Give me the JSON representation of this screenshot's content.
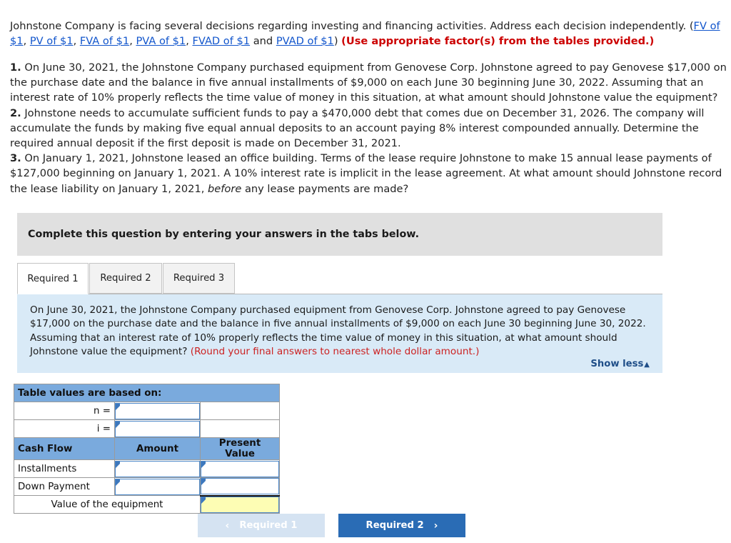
{
  "intro": {
    "lead": "Johnstone Company is facing several decisions regarding investing and financing activities. Address each decision independently. (",
    "links": [
      "FV of $1",
      "PV of $1",
      "FVA of $1",
      "PVA of $1",
      "FVAD of $1",
      "PVAD of $1"
    ],
    "sep": ", ",
    "and_word": " and ",
    "close": ") ",
    "note": "(Use appropriate factor(s) from the tables provided.)"
  },
  "questions": [
    {
      "num": "1.",
      "text": " On June 30, 2021, the Johnstone Company purchased equipment from Genovese Corp. Johnstone agreed to pay Genovese $17,000 on the purchase date and the balance in five annual installments of $9,000 on each June 30 beginning June 30, 2022. Assuming that an interest rate of 10% properly reflects the time value of money in this situation, at what amount should Johnstone value the equipment?"
    },
    {
      "num": "2.",
      "text": " Johnstone needs to accumulate sufficient funds to pay a $470,000 debt that comes due on December 31, 2026. The company will accumulate the funds by making five equal annual deposits to an account paying 8% interest compounded annually. Determine the required annual deposit if the first deposit is made on December 31, 2021."
    },
    {
      "num": "3.",
      "text_before_italic": " On January 1, 2021, Johnstone leased an office building. Terms of the lease require Johnstone to make 15 annual lease payments of $127,000 beginning on January 1, 2021. A 10% interest rate is implicit in the lease agreement. At what amount should Johnstone record the lease liability on January 1, 2021, ",
      "italic": "before",
      "text_after_italic": " any lease payments are made?"
    }
  ],
  "banner": {
    "text": "Complete this question by entering your answers in the tabs below."
  },
  "tabs": [
    {
      "label": "Required 1",
      "active": true
    },
    {
      "label": "Required 2",
      "active": false
    },
    {
      "label": "Required 3",
      "active": false
    }
  ],
  "info_panel": {
    "body": "On June 30, 2021, the Johnstone Company purchased equipment from Genovese Corp. Johnstone agreed to pay Genovese $17,000 on the purchase date and the balance in five annual installments of $9,000 on each June 30 beginning June 30, 2022. Assuming that an interest rate of 10% properly reflects the time value of money in this situation, at what amount should Johnstone value the equipment? ",
    "round_note": "(Round your final answers to nearest whole dollar amount.)",
    "show_less_label": "Show less",
    "show_less_caret": "▲"
  },
  "answer_table": {
    "title": "Table values are based on:",
    "n_label": "n =",
    "n_value": "",
    "i_label": "i =",
    "i_value": "",
    "headers": {
      "cash_flow": "Cash Flow",
      "amount": "Amount",
      "present_value": "Present Value"
    },
    "rows": [
      {
        "label": "Installments",
        "amount": "",
        "present_value": ""
      },
      {
        "label": "Down Payment",
        "amount": "",
        "present_value": ""
      }
    ],
    "total_label": "Value of the equipment",
    "total_value": ""
  },
  "nav": {
    "prev_label": "Required 1",
    "next_label": "Required 2",
    "prev_chevron": "‹",
    "next_chevron": "›"
  },
  "colors": {
    "link": "#1155cc",
    "red_note": "#cc0000",
    "table_header_blue": "#7aaadd",
    "panel_blue": "#d9eaf7",
    "banner_gray": "#e0e0e0",
    "button_blue": "#2a6cb5",
    "button_disabled": "#d5e3f2",
    "input_yellow": "#fdfdb4"
  }
}
